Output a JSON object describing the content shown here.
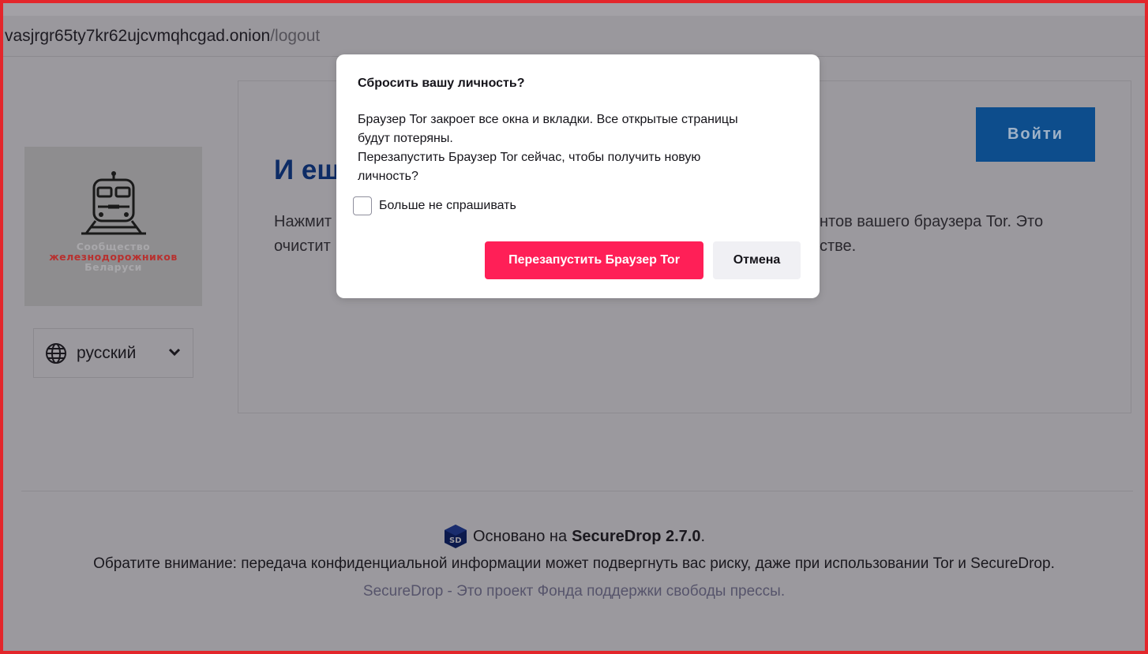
{
  "address_bar": {
    "host": "vasjrgr65ty7kr62ujcvmqhcgad.onion",
    "path": "/logout"
  },
  "logo": {
    "line1": "Сообщество",
    "line2": "железнодорожников",
    "line3": "Беларуси"
  },
  "language_selector": {
    "selected": "русский"
  },
  "page": {
    "login_button": "Войти",
    "heading_visible": "И ещ",
    "paragraph_left_line1": "Нажмит",
    "paragraph_left_line2": "очистит",
    "paragraph_right_line1": "нтов вашего браузера Tor. Это",
    "paragraph_right_line2": "стве."
  },
  "footer": {
    "based_on_prefix": "Основано на",
    "based_on_product": "SecureDrop 2.7.0",
    "based_on_suffix": ".",
    "warning": "Обратите внимание: передача конфиденциальной информации может подвергнуть вас риску, даже при использовании Tor и SecureDrop.",
    "project_note": "SecureDrop - Это проект Фонда поддержки свободы прессы."
  },
  "dialog": {
    "title": "Сбросить вашу личность?",
    "body_line1": "Браузер Tor закроет все окна и вкладки. Все открытые страницы",
    "body_line2": "будут потеряны.",
    "body_line3": "Перезапустить Браузер Tor сейчас, чтобы получить новую",
    "body_line4": "личность?",
    "checkbox_label": "Больше не спрашивать",
    "confirm_button": "Перезапустить Браузер Tor",
    "cancel_button": "Отмена"
  },
  "colors": {
    "confirm_button_bg": "#ff1f57",
    "login_button_bg": "#0d4d8c",
    "frame_border": "#e3262b"
  }
}
